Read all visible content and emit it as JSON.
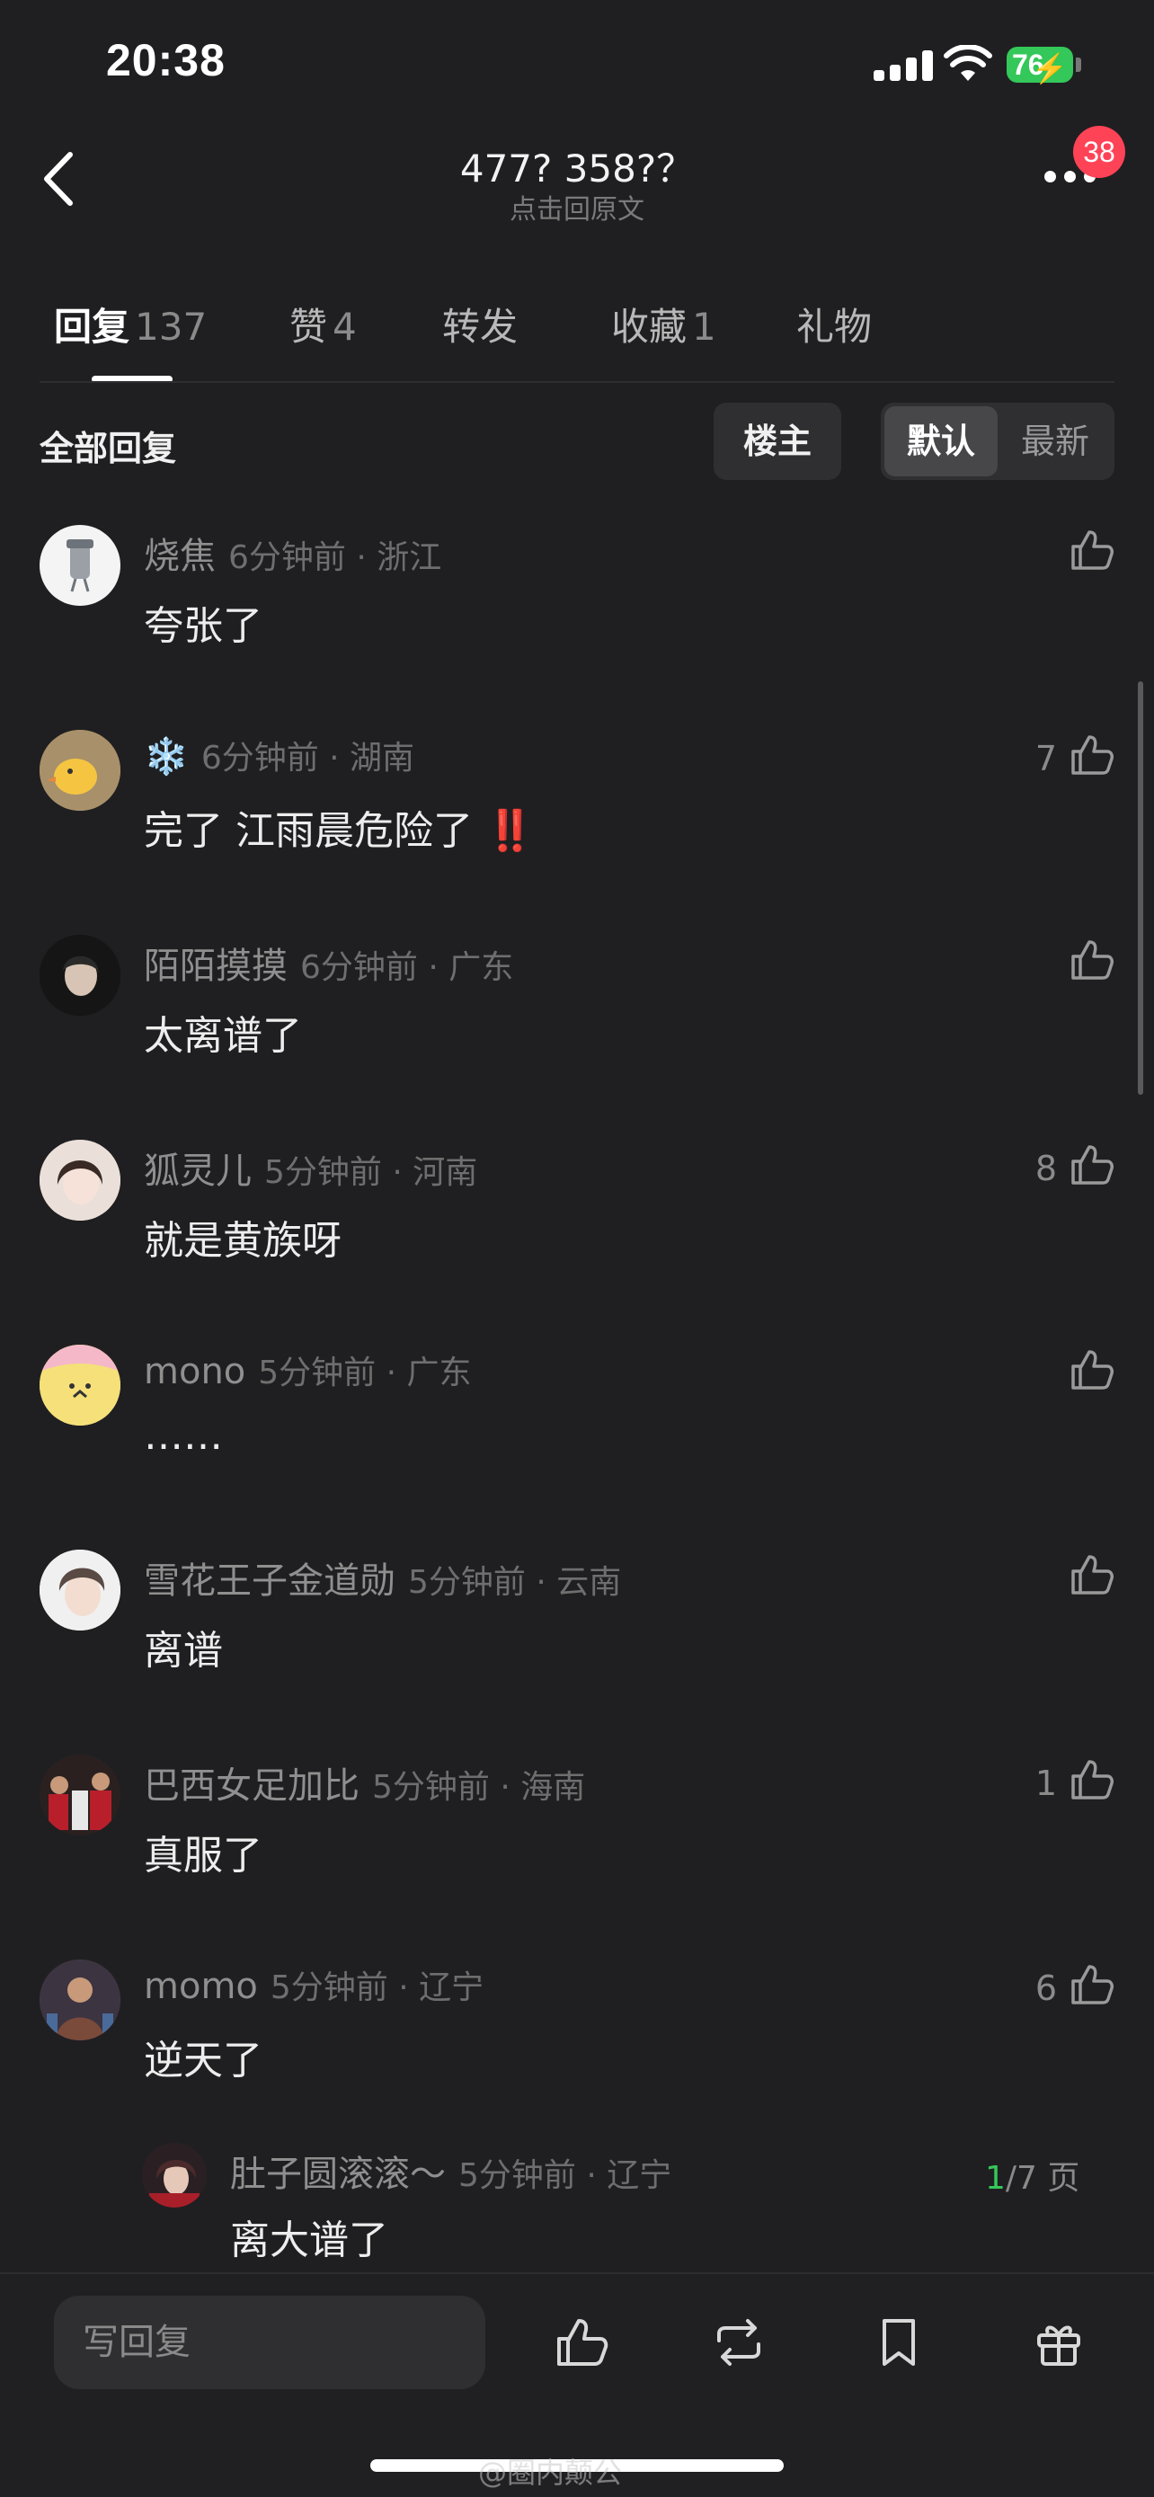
{
  "status_bar": {
    "time": "20:38",
    "battery": "76"
  },
  "header": {
    "title": "477?  358?？",
    "subtitle": "点击回原文",
    "badge": "38"
  },
  "tabs": [
    {
      "label": "回复",
      "count": "137"
    },
    {
      "label": "赞",
      "count": "4"
    },
    {
      "label": "转发",
      "count": ""
    },
    {
      "label": "收藏",
      "count": "1"
    },
    {
      "label": "礼物",
      "count": ""
    }
  ],
  "filter": {
    "all_label": "全部回复",
    "owner_label": "楼主",
    "sort_default": "默认",
    "sort_latest": "最新"
  },
  "comments": [
    {
      "name": "烧焦",
      "meta": "6分钟前 · 浙江",
      "text": "夸张了",
      "likes": ""
    },
    {
      "name": "❄️",
      "meta": "6分钟前 · 湖南",
      "text": "完了 江雨晨危险了",
      "suffix": "‼️",
      "likes": "7"
    },
    {
      "name": "陌陌摸摸",
      "meta": "6分钟前 · 广东",
      "text": "太离谱了",
      "likes": ""
    },
    {
      "name": "狐灵儿",
      "meta": "5分钟前 · 河南",
      "text": "就是黄族呀",
      "likes": "8"
    },
    {
      "name": "mono",
      "meta": "5分钟前 · 广东",
      "text": "……",
      "likes": ""
    },
    {
      "name": "雪花王子金道勋",
      "meta": "5分钟前 · 云南",
      "text": "离谱",
      "likes": ""
    },
    {
      "name": "巴西女足加比",
      "meta": "5分钟前 · 海南",
      "text": "真服了",
      "likes": "1"
    },
    {
      "name": "momo",
      "meta": "5分钟前 · 辽宁",
      "text": "逆天了",
      "likes": "6"
    }
  ],
  "sub_reply": {
    "name": "肚子圆滚滚～",
    "meta": "5分钟前 · 辽宁",
    "text": "离大谱了",
    "page_current": "1",
    "page_total": "/7 页"
  },
  "bottom_bar": {
    "placeholder": "写回复"
  },
  "watermark": "@圈内颠公",
  "colors": {
    "background": "#1f1f21",
    "badge": "#ff4357",
    "battery": "#34c759",
    "pager_current": "#34c759"
  }
}
